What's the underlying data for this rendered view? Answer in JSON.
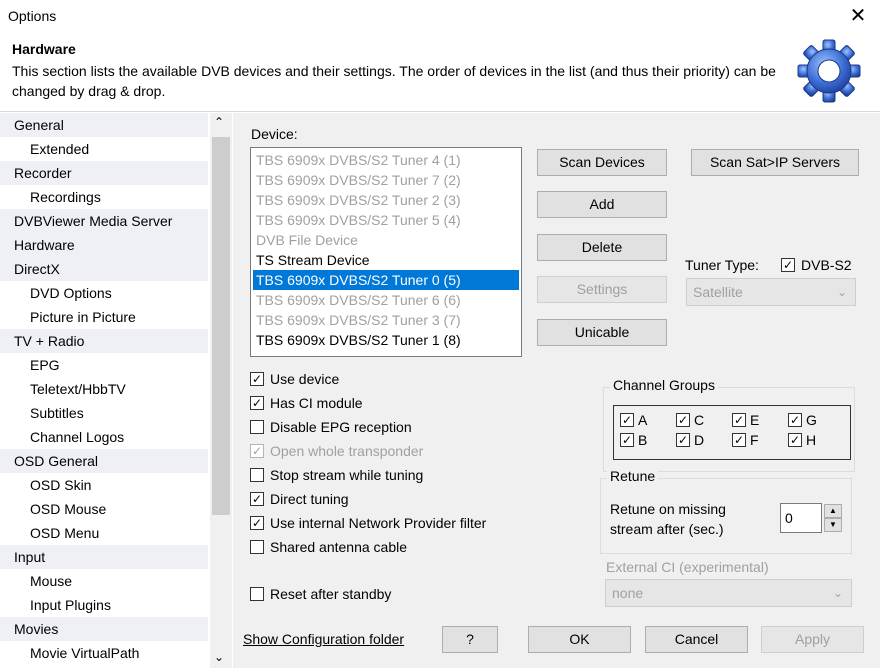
{
  "window": {
    "title": "Options",
    "close_glyph": "✕"
  },
  "header": {
    "title": "Hardware",
    "description": "This section lists the available DVB devices and their settings. The order of devices in the list (and thus their priority) can be changed by drag & drop.",
    "icon": "gear-icon"
  },
  "sidebar": {
    "items": [
      {
        "label": "General",
        "level": 0
      },
      {
        "label": "Extended",
        "level": 1
      },
      {
        "label": "Recorder",
        "level": 0
      },
      {
        "label": "Recordings",
        "level": 1
      },
      {
        "label": "DVBViewer Media Server",
        "level": 0
      },
      {
        "label": "Hardware",
        "level": 0
      },
      {
        "label": "DirectX",
        "level": 0
      },
      {
        "label": "DVD Options",
        "level": 1
      },
      {
        "label": "Picture in Picture",
        "level": 1
      },
      {
        "label": "TV + Radio",
        "level": 0
      },
      {
        "label": "EPG",
        "level": 1
      },
      {
        "label": "Teletext/HbbTV",
        "level": 1
      },
      {
        "label": "Subtitles",
        "level": 1
      },
      {
        "label": "Channel Logos",
        "level": 1
      },
      {
        "label": "OSD General",
        "level": 0
      },
      {
        "label": "OSD Skin",
        "level": 1
      },
      {
        "label": "OSD Mouse",
        "level": 1
      },
      {
        "label": "OSD Menu",
        "level": 1
      },
      {
        "label": "Input",
        "level": 0
      },
      {
        "label": "Mouse",
        "level": 1
      },
      {
        "label": "Input Plugins",
        "level": 1
      },
      {
        "label": "Movies",
        "level": 0
      },
      {
        "label": "Movie VirtualPath",
        "level": 1
      }
    ]
  },
  "device": {
    "label": "Device:",
    "list": [
      {
        "label": "TBS 6909x DVBS/S2 Tuner 4 (1)",
        "state": "disabled"
      },
      {
        "label": "TBS 6909x DVBS/S2 Tuner 7 (2)",
        "state": "disabled"
      },
      {
        "label": "TBS 6909x DVBS/S2 Tuner 2 (3)",
        "state": "disabled"
      },
      {
        "label": "TBS 6909x DVBS/S2 Tuner 5 (4)",
        "state": "disabled"
      },
      {
        "label": "DVB File Device",
        "state": "disabled"
      },
      {
        "label": "TS Stream Device",
        "state": "normal"
      },
      {
        "label": "TBS 6909x DVBS/S2 Tuner 0 (5)",
        "state": "selected"
      },
      {
        "label": "TBS 6909x DVBS/S2 Tuner 6 (6)",
        "state": "disabled"
      },
      {
        "label": "TBS 6909x DVBS/S2 Tuner 3 (7)",
        "state": "disabled"
      },
      {
        "label": "TBS 6909x DVBS/S2 Tuner 1 (8)",
        "state": "normal"
      }
    ]
  },
  "buttons": {
    "scan_devices": "Scan Devices",
    "scan_satip": "Scan Sat>IP Servers",
    "add": "Add",
    "delete": "Delete",
    "settings": "Settings",
    "unicable": "Unicable"
  },
  "tuner": {
    "label": "Tuner Type:",
    "dvbs2_label": "DVB-S2",
    "dvbs2_checked": true,
    "type_value": "Satellite"
  },
  "options": {
    "use_device": {
      "label": "Use device",
      "checked": true
    },
    "has_ci": {
      "label": "Has CI module",
      "checked": true
    },
    "disable_epg": {
      "label": "Disable EPG reception",
      "checked": false
    },
    "open_transponder": {
      "label": "Open whole transponder",
      "checked": true
    },
    "stop_stream": {
      "label": "Stop stream while tuning",
      "checked": false
    },
    "direct_tuning": {
      "label": "Direct tuning",
      "checked": true
    },
    "network_filter": {
      "label": "Use internal Network Provider filter",
      "checked": true
    },
    "shared_antenna": {
      "label": "Shared antenna cable",
      "checked": false
    },
    "reset_standby": {
      "label": "Reset after standby",
      "checked": false
    }
  },
  "channel_groups": {
    "title": "Channel Groups",
    "groups": [
      {
        "label": "A",
        "checked": true
      },
      {
        "label": "C",
        "checked": true
      },
      {
        "label": "E",
        "checked": true
      },
      {
        "label": "G",
        "checked": true
      },
      {
        "label": "B",
        "checked": true
      },
      {
        "label": "D",
        "checked": true
      },
      {
        "label": "F",
        "checked": true
      },
      {
        "label": "H",
        "checked": true
      }
    ]
  },
  "retune": {
    "title": "Retune",
    "label_line1": "Retune on missing",
    "label_line2": "stream after (sec.)",
    "value": "0"
  },
  "external_ci": {
    "label": "External CI (experimental)",
    "value": "none"
  },
  "footer": {
    "show_config": "Show Configuration folder",
    "help": "?",
    "ok": "OK",
    "cancel": "Cancel",
    "apply": "Apply"
  }
}
